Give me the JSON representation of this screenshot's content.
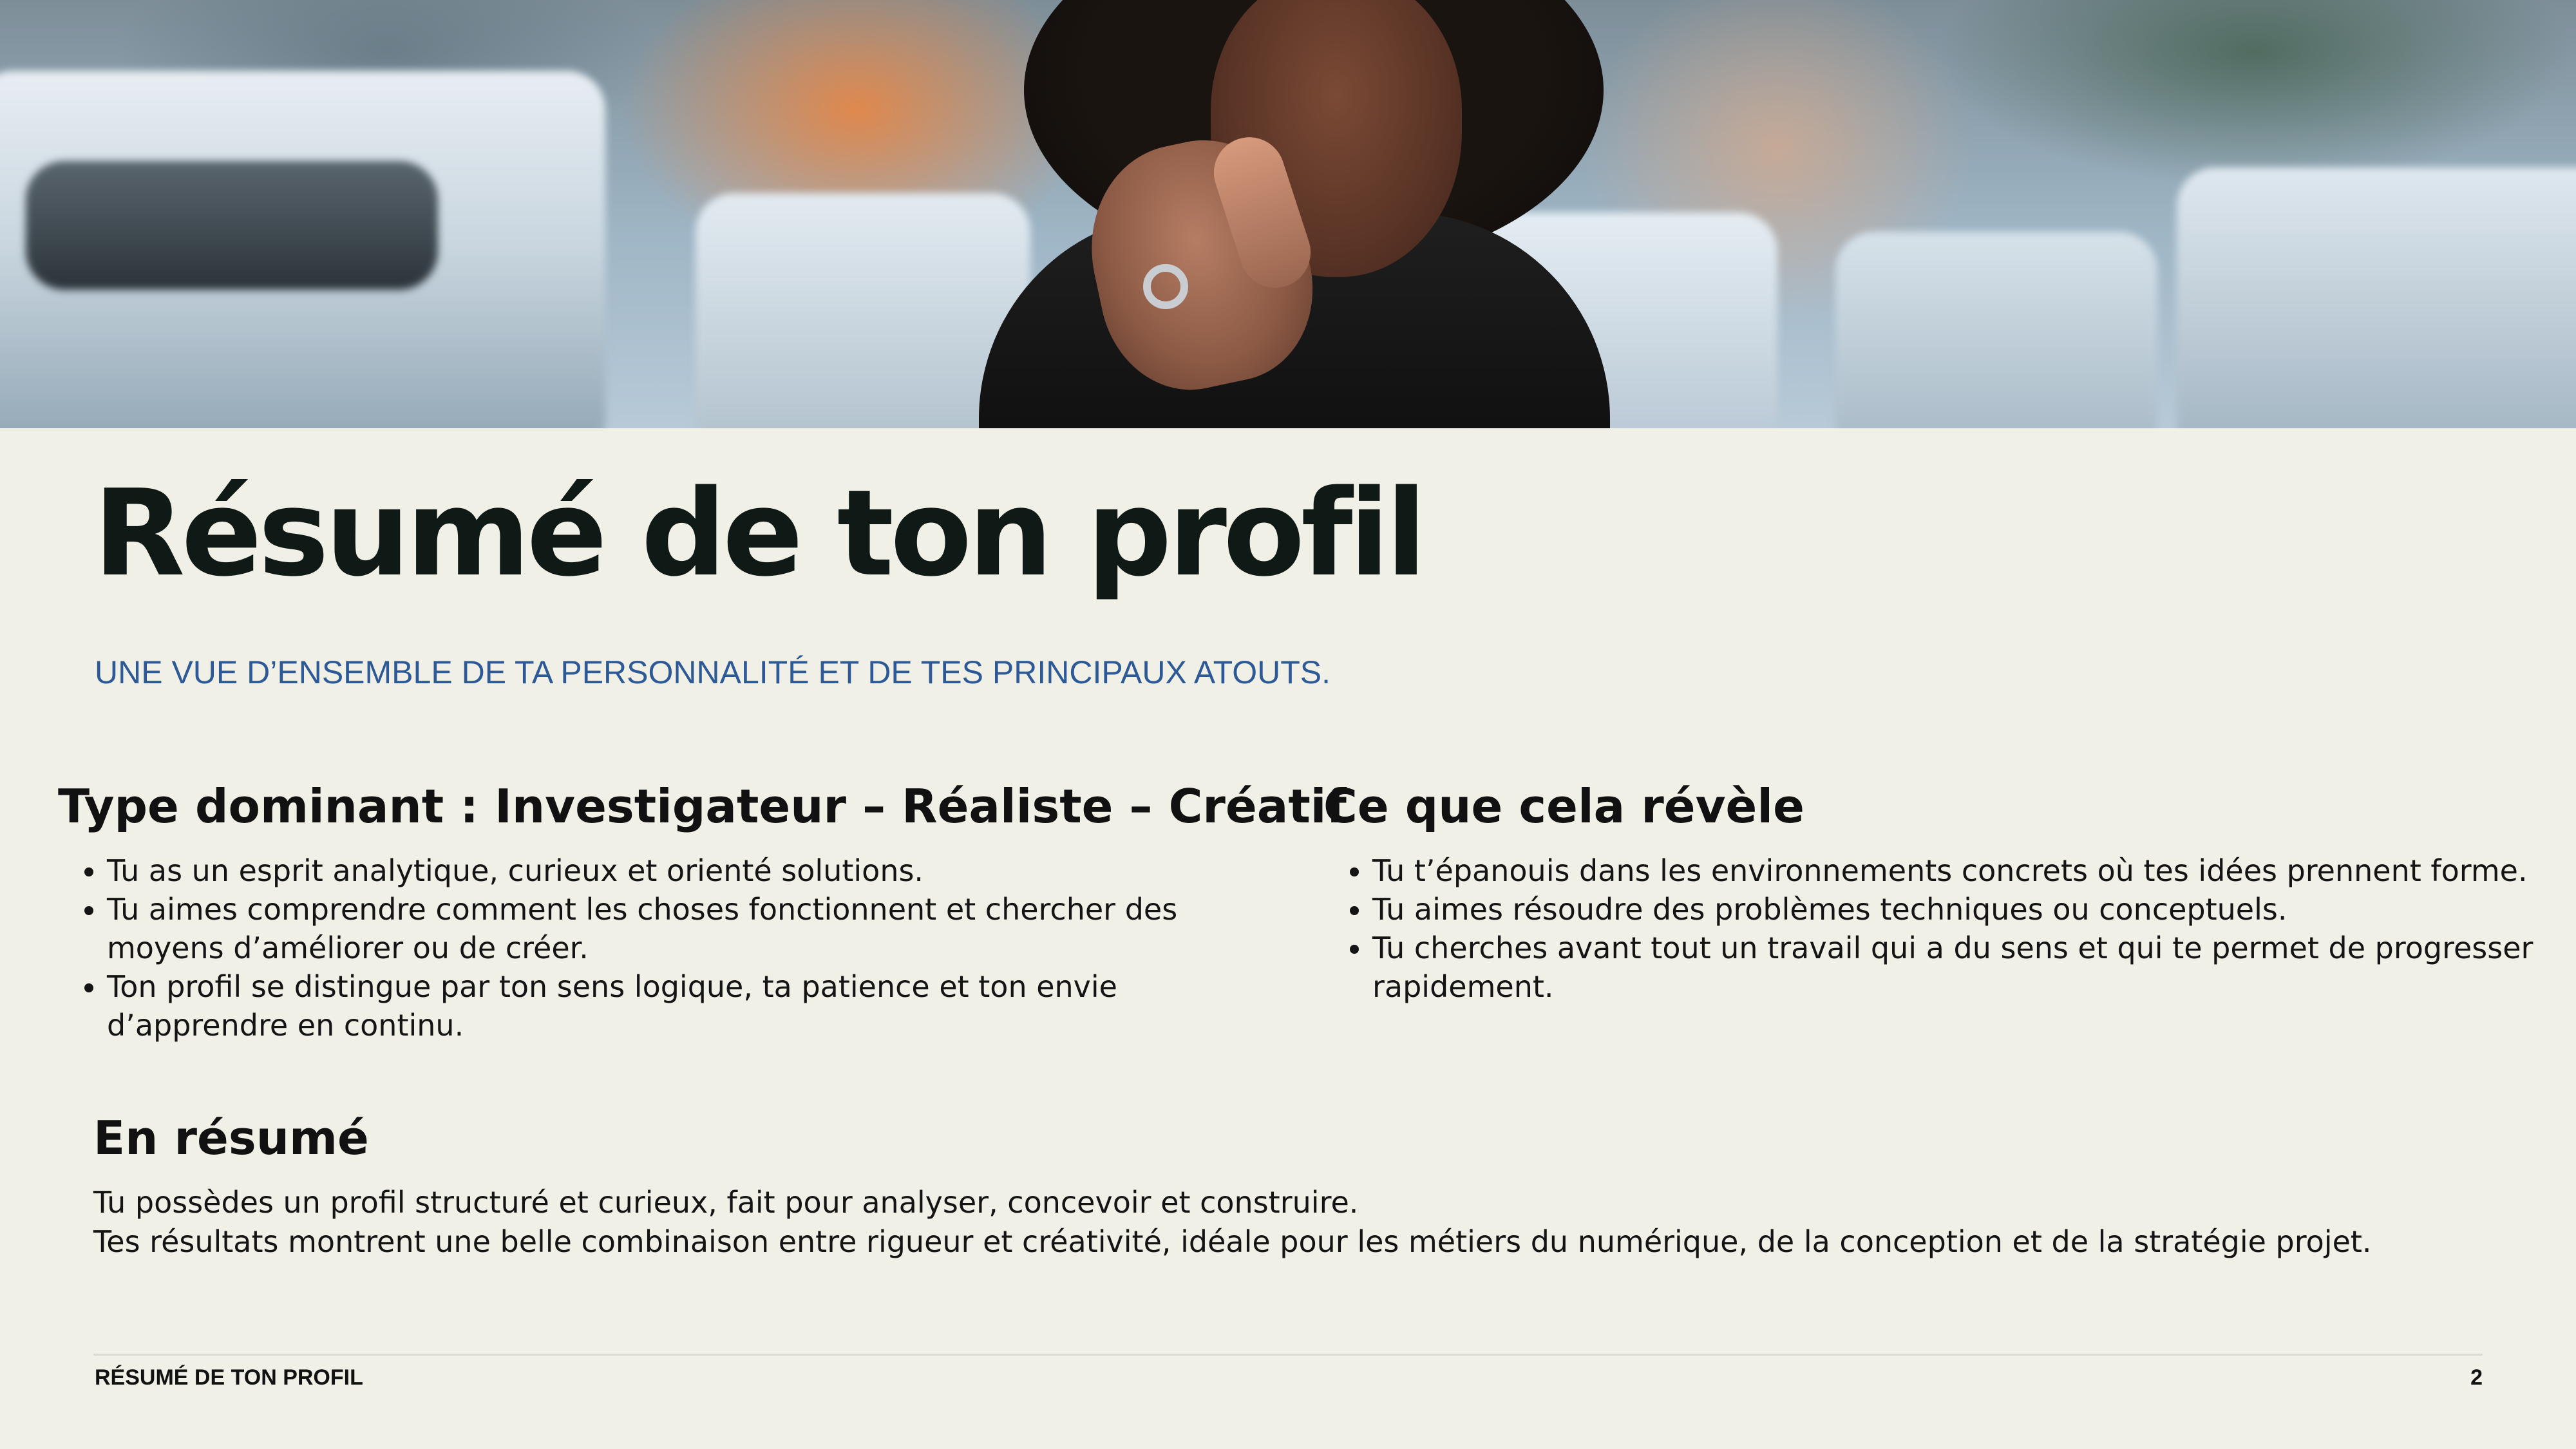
{
  "hero": {
    "image_description": "photo"
  },
  "title": "Résumé de ton profil",
  "subtitle": "UNE VUE D’ENSEMBLE DE TA PERSONNALITÉ ET DE TES PRINCIPAUX ATOUTS.",
  "left_section": {
    "heading": "Type dominant : Investigateur – Réaliste – Créatif",
    "bullets": [
      "Tu as un esprit analytique, curieux et orienté solutions.",
      "Tu aimes comprendre comment les choses fonctionnent et chercher des moyens d’améliorer ou de créer.",
      "Ton profil se distingue par ton sens logique, ta patience et ton envie d’apprendre en continu."
    ]
  },
  "right_section": {
    "heading": "Ce que cela révèle",
    "bullets": [
      "Tu t’épanouis dans les environnements concrets où tes idées prennent forme.",
      "Tu aimes résoudre des problèmes techniques ou conceptuels.",
      "Tu cherches avant tout un travail qui a du sens et qui te permet de progresser rapidement."
    ]
  },
  "summary": {
    "heading": "En résumé",
    "lines": [
      "Tu possèdes un profil structuré et curieux, fait pour analyser, concevoir et construire.",
      "Tes résultats montrent une belle combinaison entre rigueur et créativité, idéale pour les métiers du numérique, de la conception et de la stratégie projet."
    ]
  },
  "footer": {
    "label": "RÉSUMÉ DE TON PROFIL",
    "page_number": "2"
  },
  "colors": {
    "background": "#f1f0e7",
    "title": "#0f1a17",
    "subtitle": "#2d5a96"
  }
}
